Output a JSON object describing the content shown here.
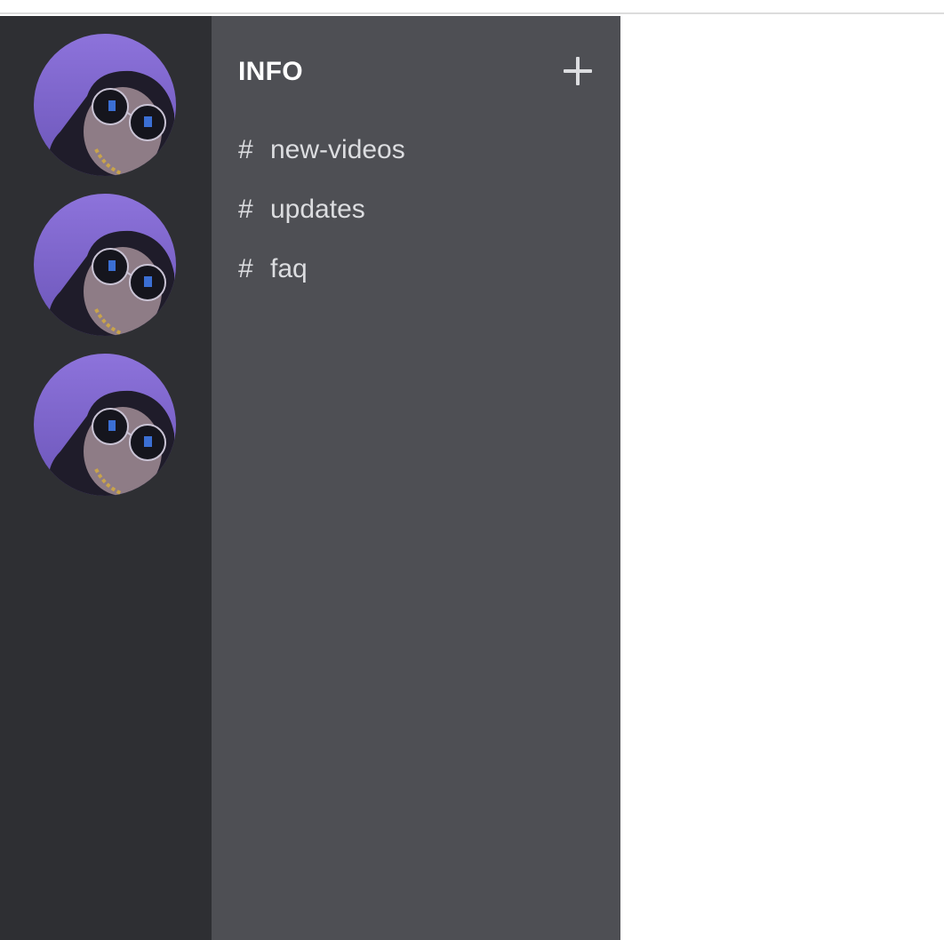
{
  "servers": [
    {
      "avatar_icon": "cat-with-sunglasses-avatar"
    },
    {
      "avatar_icon": "cat-with-sunglasses-avatar"
    },
    {
      "avatar_icon": "cat-with-sunglasses-avatar"
    }
  ],
  "channel_panel": {
    "category_title": "INFO",
    "add_icon": "plus-icon",
    "channels": [
      {
        "hash": "#",
        "name": "new-videos"
      },
      {
        "hash": "#",
        "name": "updates"
      },
      {
        "hash": "#",
        "name": "faq"
      }
    ]
  },
  "colors": {
    "server_rail_bg": "#2e2f33",
    "channel_panel_bg": "#4e4f54",
    "text_primary": "#ffffff",
    "text_channel": "#dcdde0",
    "avatar_bg": "#8a6fd6"
  }
}
